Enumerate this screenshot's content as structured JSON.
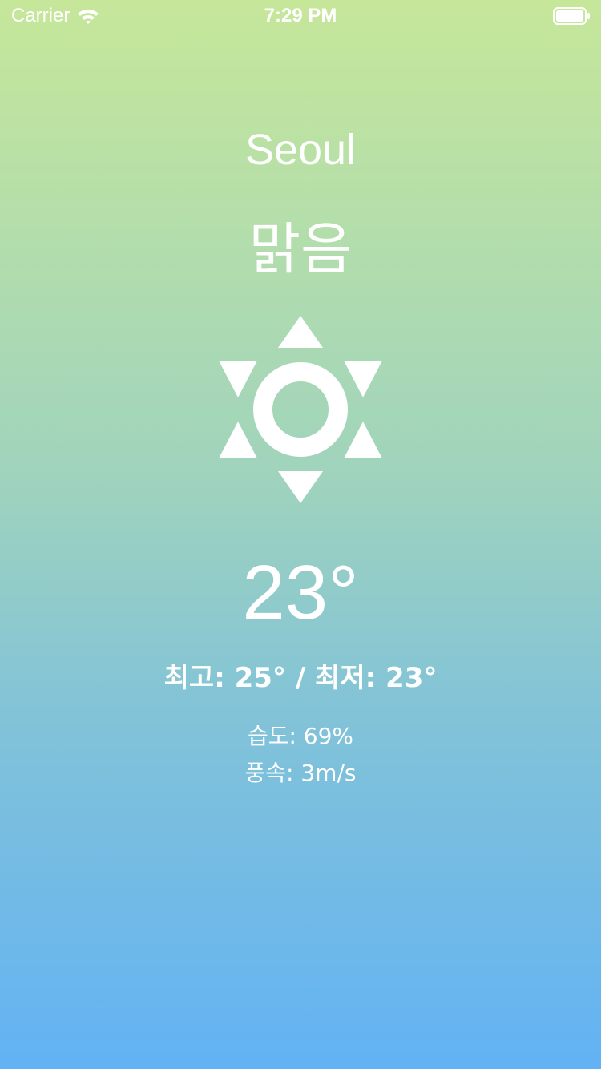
{
  "status_bar": {
    "carrier": "Carrier",
    "time": "7:29 PM",
    "icons": [
      "wifi-icon",
      "battery-icon"
    ]
  },
  "weather": {
    "city": "Seoul",
    "condition": "맑음",
    "icon": "sun-icon",
    "temperature": "23°",
    "high_low": "최고: 25° / 최저: 23°",
    "humidity": "습도: 69%",
    "wind": "풍속: 3m/s"
  },
  "colors": {
    "gradient_top": "#c6e79a",
    "gradient_bottom": "#62b2f4",
    "text": "#ffffff"
  }
}
